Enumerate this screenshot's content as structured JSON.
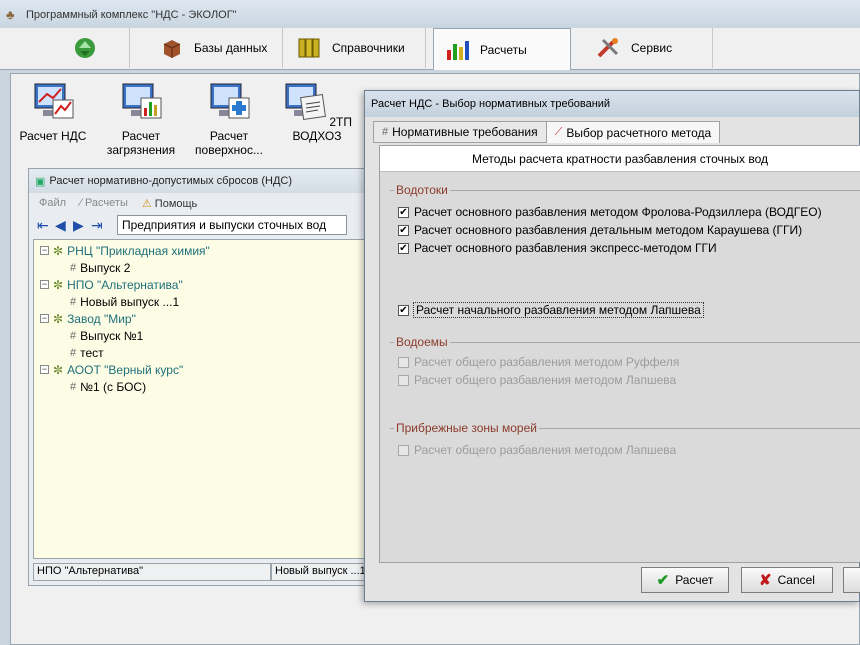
{
  "app": {
    "title": "Программный комплекс \"НДС - ЭКОЛОГ\""
  },
  "main_tabs": [
    {
      "label": "",
      "icon": "recycle-icon"
    },
    {
      "label": "Базы данных",
      "icon": "database-cube-icon"
    },
    {
      "label": "Справочники",
      "icon": "binders-icon"
    },
    {
      "label": "Расчеты",
      "icon": "bar-chart-icon",
      "active": true
    },
    {
      "label": "Сервис",
      "icon": "tools-icon"
    }
  ],
  "toolbar": [
    {
      "label": "Расчет НДС",
      "icon": "computer-chart-icon"
    },
    {
      "label": "Расчет загрязнения",
      "icon": "computer-bars-icon"
    },
    {
      "label": "Расчет поверхнос...",
      "icon": "computer-medical-icon"
    },
    {
      "label": "2ТП ВОДХОЗ",
      "icon": "computer-document-icon"
    }
  ],
  "inner": {
    "title": "Расчет нормативно-допустимых сбросов (НДС)",
    "menu": [
      "Файл",
      "Расчеты",
      "Помощь"
    ],
    "combo": "Предприятия и выпуски сточных вод",
    "tree": [
      {
        "label": "РНЦ \"Прикладная химия\"",
        "children": [
          "Выпуск 2"
        ]
      },
      {
        "label": "НПО \"Альтернатива\"",
        "children": [
          "Новый выпуск ...1"
        ]
      },
      {
        "label": "Завод \"Мир\"",
        "children": [
          "Выпуск №1",
          "тест"
        ]
      },
      {
        "label": "АООТ \"Верный курс\"",
        "children": [
          "№1 (с БОС)"
        ]
      }
    ],
    "status": [
      "НПО \"Альтернатива\"",
      "Новый выпуск ...1"
    ]
  },
  "dialog": {
    "title": "Расчет НДС - Выбор нормативных требований",
    "tabs": [
      "Нормативные требования",
      "Выбор расчетного метода"
    ],
    "header": "Методы расчета кратности разбавления сточных вод",
    "groups": [
      {
        "label": "Водотоки",
        "items": [
          {
            "text": "Расчет основного разбавления методом Фролова-Родзиллера (ВОДГЕО)",
            "checked": true,
            "disabled": false
          },
          {
            "text": "Расчет основного разбавления детальным методом Караушева (ГГИ)",
            "checked": true,
            "disabled": false
          },
          {
            "text": "Расчет основного разбавления экспресс-методом ГГИ",
            "checked": true,
            "disabled": false
          },
          {
            "text": "Расчет начального разбавления методом Лапшева",
            "checked": true,
            "disabled": false
          }
        ]
      },
      {
        "label": "Водоемы",
        "items": [
          {
            "text": "Расчет общего разбавления методом Руффеля",
            "checked": false,
            "disabled": true
          },
          {
            "text": "Расчет общего разбавления методом Лапшева",
            "checked": false,
            "disabled": true
          }
        ]
      },
      {
        "label": "Прибрежные зоны морей",
        "items": [
          {
            "text": "Расчет общего разбавления методом Лапшева",
            "checked": false,
            "disabled": true
          }
        ]
      }
    ],
    "buttons": {
      "ok": "Расчет",
      "cancel": "Cancel"
    }
  }
}
